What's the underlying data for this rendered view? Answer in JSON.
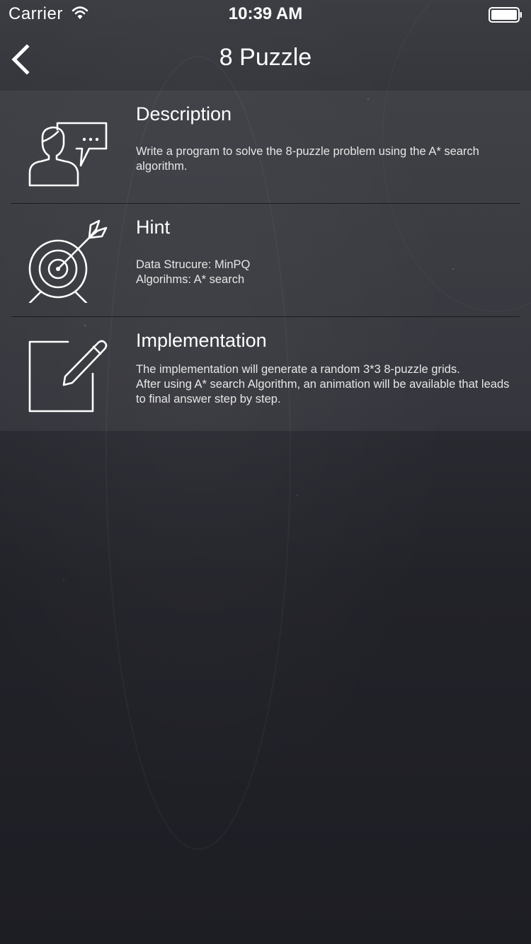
{
  "status_bar": {
    "carrier": "Carrier",
    "time": "10:39 AM",
    "wifi_icon": "wifi-icon",
    "battery_icon": "battery-icon"
  },
  "nav": {
    "title": "8 Puzzle",
    "back_icon": "chevron-left-icon"
  },
  "sections": [
    {
      "title": "Description",
      "icon": "person-speech-bubble-icon",
      "lines": [
        "Write a program to solve the 8-puzzle problem using the A* search algorithm."
      ]
    },
    {
      "title": "Hint",
      "icon": "target-arrow-icon",
      "lines": [
        "Data Strucure:  MinPQ",
        "Algorihms:  A* search"
      ]
    },
    {
      "title": "Implementation",
      "icon": "pencil-edit-icon",
      "lines": [
        "The implementation will generate a random 3*3 8-puzzle grids.",
        "After using A* search Algorithm, an animation will be available that leads to final answer step by step."
      ]
    }
  ],
  "colors": {
    "background_top": "#3b3d43",
    "background_bottom": "#1d1d24",
    "text": "#ffffff",
    "divider": "#000000"
  }
}
